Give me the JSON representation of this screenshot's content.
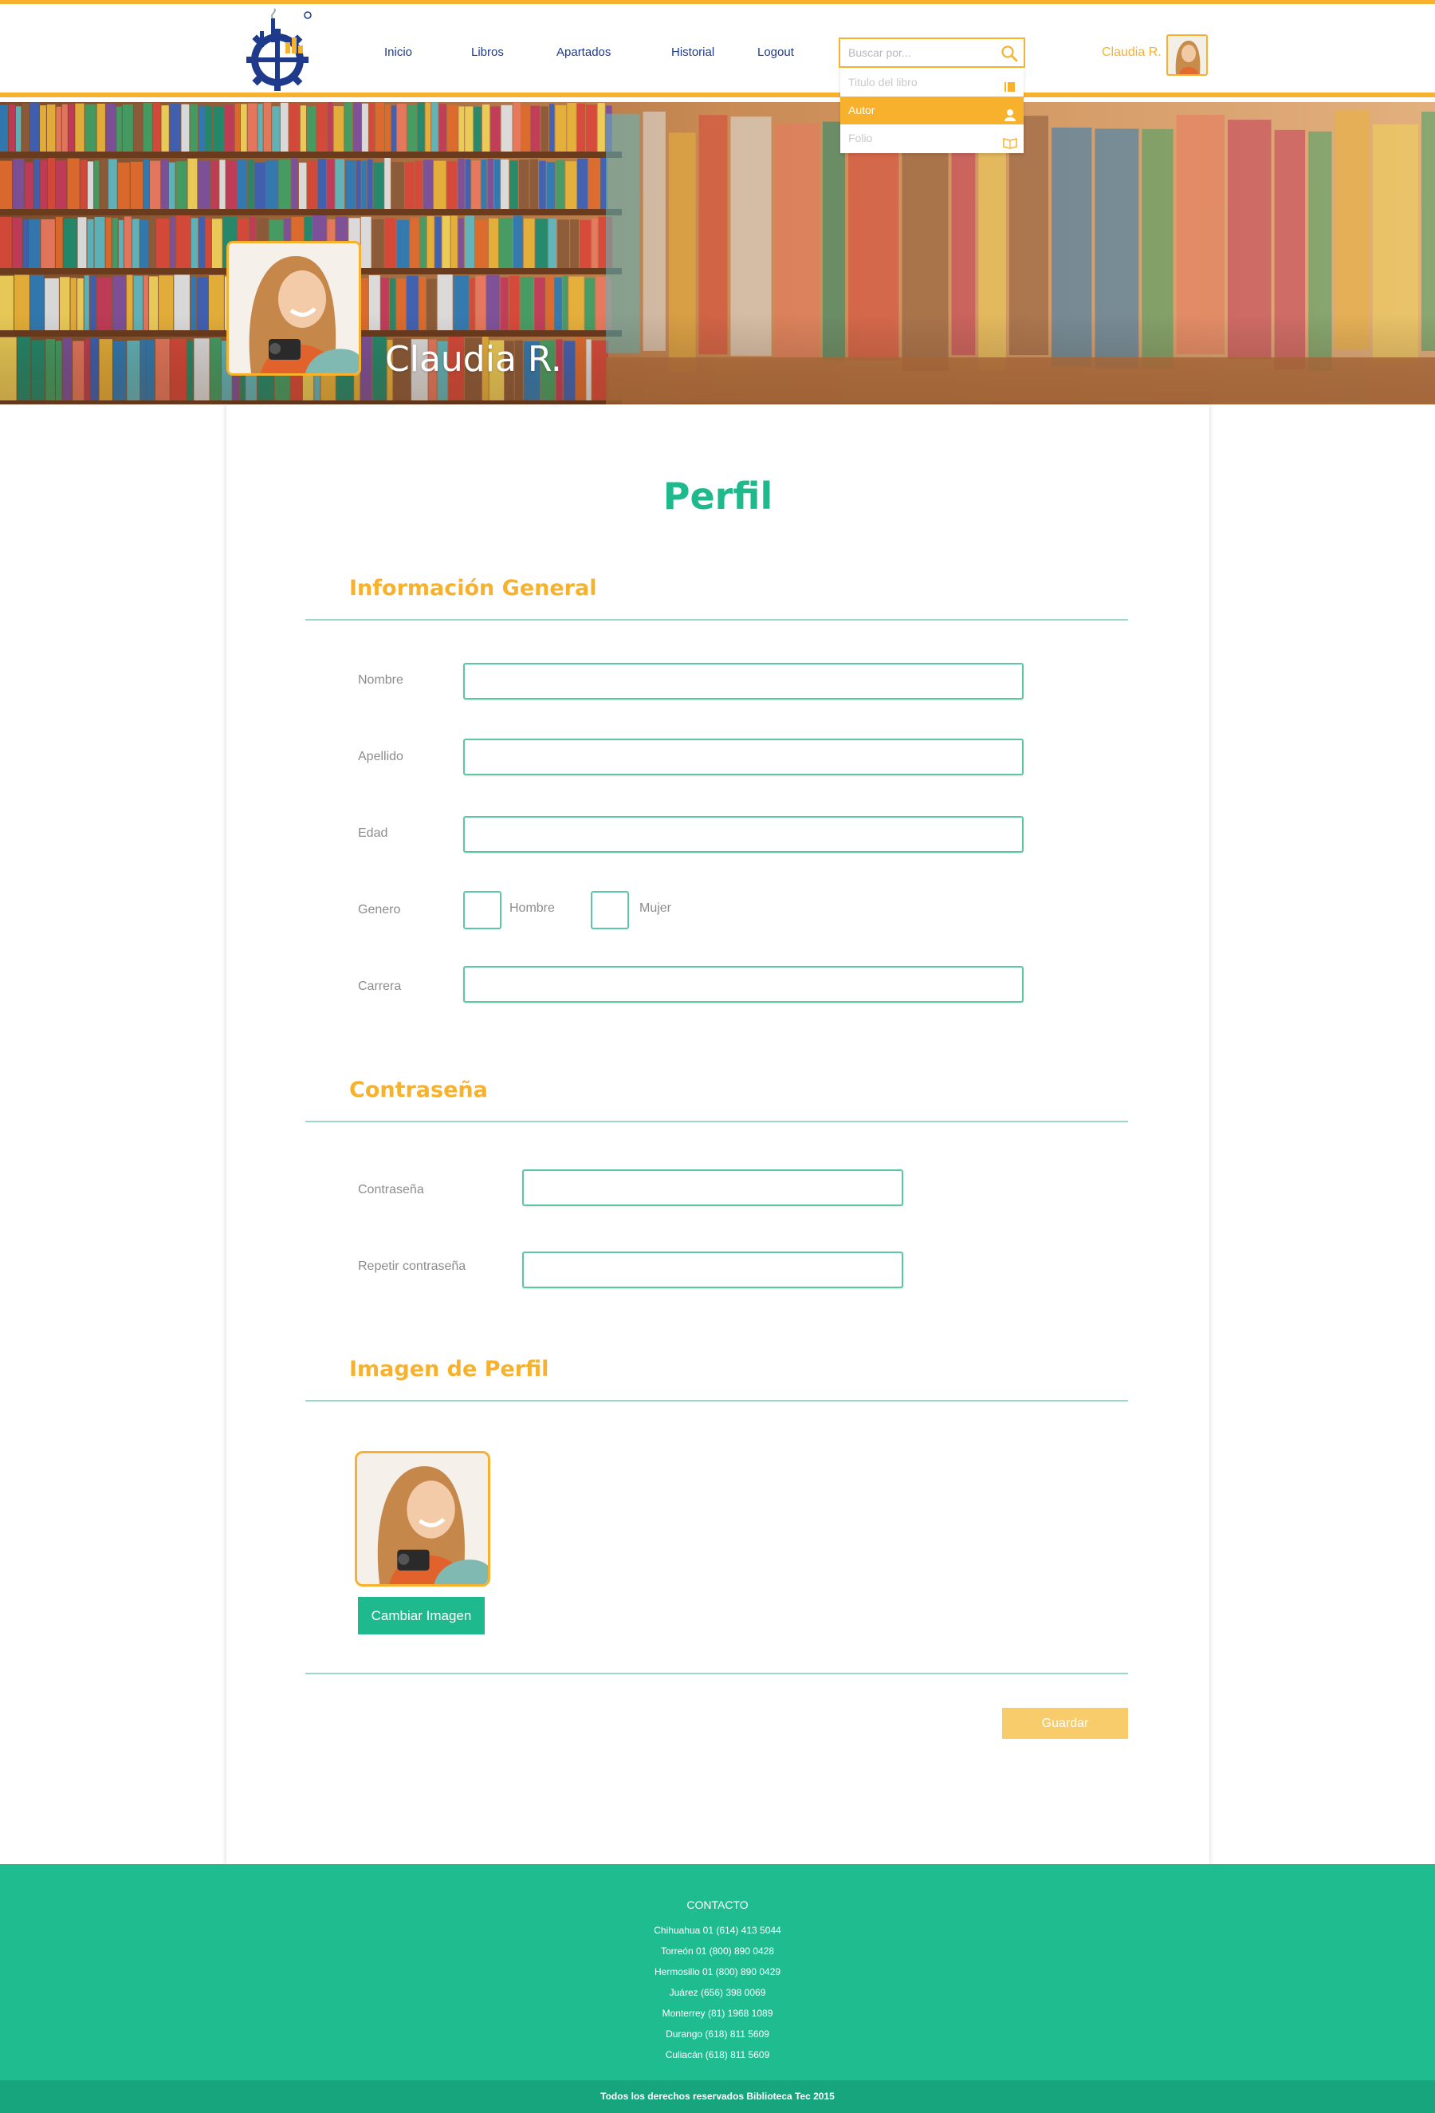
{
  "header": {
    "nav": [
      "Inicio",
      "Libros",
      "Apartados",
      "Historial",
      "Logout"
    ],
    "search_placeholder": "Buscar por...",
    "user_name": "Claudia R."
  },
  "search_dropdown": {
    "options": [
      "Titulo del libro",
      "Autor",
      "Folio"
    ],
    "selected": "Autor"
  },
  "banner": {
    "name": "Claudia R."
  },
  "main": {
    "title": "Perfil",
    "general": {
      "title": "Información General",
      "fields": {
        "nombre": {
          "label": "Nombre",
          "value": ""
        },
        "apellido": {
          "label": "Apellido",
          "value": ""
        },
        "edad": {
          "label": "Edad",
          "value": ""
        },
        "genero": {
          "label": "Genero",
          "options": [
            "Hombre",
            "Mujer"
          ]
        },
        "carrera": {
          "label": "Carrera",
          "value": ""
        }
      }
    },
    "password": {
      "title": "Contraseña",
      "label": "Contraseña",
      "repeat_label": "Repetir contraseña"
    },
    "image": {
      "title": "Imagen de Perfil",
      "change_button": "Cambiar Imagen"
    },
    "save_button": "Guardar"
  },
  "footer": {
    "title": "CONTACTO",
    "contacts": [
      "Chihuahua 01 (614) 413 5044",
      "Torreón 01 (800) 890 0428",
      "Hermosillo 01 (800) 890 0429",
      "Juárez (656) 398 0069",
      "Monterrey (81) 1968 1089",
      "Durango (618) 811 5609",
      "Culiacán (618) 811 5609"
    ],
    "copyright": "Todos los derechos reservados Biblioteca Tec 2015"
  },
  "colors": {
    "accent": "#f7b12c",
    "primary": "#1fb98e",
    "nav_text": "#1f3a8a",
    "input_border": "#5cc7a4"
  }
}
